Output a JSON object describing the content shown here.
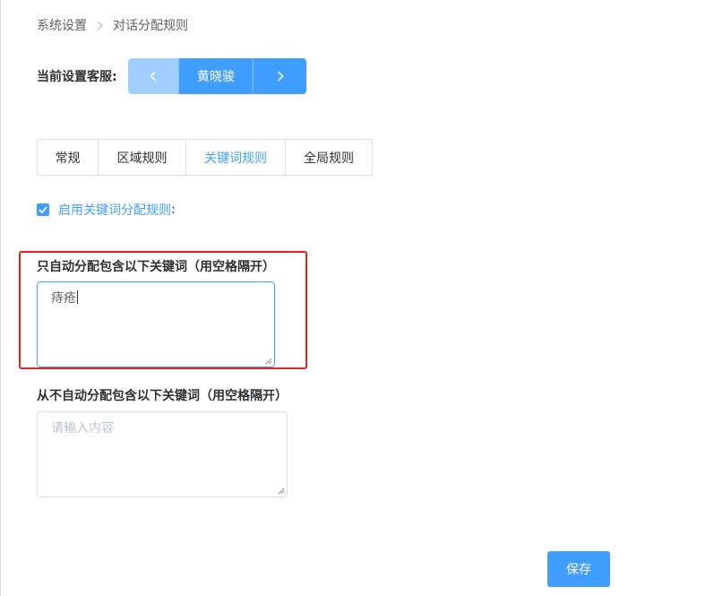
{
  "breadcrumb": {
    "items": [
      "系统设置",
      "对话分配规则"
    ]
  },
  "agent": {
    "label": "当前设置客服:",
    "name": "黄晓骏"
  },
  "tabs": [
    {
      "label": "常规",
      "active": false
    },
    {
      "label": "区域规则",
      "active": false
    },
    {
      "label": "关键词规则",
      "active": true
    },
    {
      "label": "全局规则",
      "active": false
    }
  ],
  "enable": {
    "label": "启用关键词分配规则",
    "colon": ":",
    "checked": true
  },
  "include": {
    "label": "只自动分配包含以下关键词（用空格隔开）",
    "value": "痔疮"
  },
  "exclude": {
    "label": "从不自动分配包含以下关键词（用空格隔开）",
    "placeholder": "请输入内容",
    "value": ""
  },
  "save_label": "保存",
  "colors": {
    "primary": "#409eff",
    "primary_light": "#a0cfff",
    "highlight": "#e0241f",
    "border": "#dcdfe6"
  }
}
